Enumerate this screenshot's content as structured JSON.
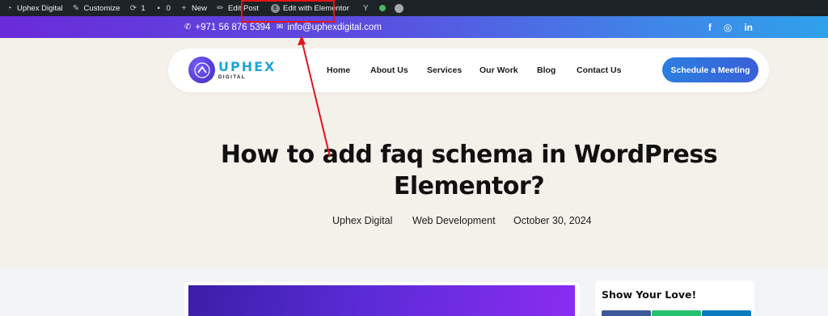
{
  "adminbar": {
    "items": [
      {
        "icon": "dashboard-icon",
        "label": "Uphex Digital"
      },
      {
        "icon": "brush-icon",
        "label": "Customize"
      },
      {
        "icon": "updates-icon",
        "label": "1"
      },
      {
        "icon": "comment-icon",
        "label": "0"
      },
      {
        "icon": "plus-icon",
        "label": "New"
      },
      {
        "icon": "pencil-icon",
        "label": "Edit Post"
      },
      {
        "icon": "elementor-icon",
        "label": "Edit with Elementor"
      }
    ],
    "highlight_color": "#e5141a"
  },
  "topbar": {
    "phone": "+971 56 876 5394",
    "email": "info@uphexdigital.com",
    "socials": [
      "f",
      "◎",
      "in"
    ]
  },
  "header": {
    "logo_text": "UPHEX",
    "logo_sub": "DIGITAL",
    "nav": [
      "Home",
      "About Us",
      "Services",
      "Our Work",
      "Blog",
      "Contact Us"
    ],
    "cta": "Schedule a Meeting"
  },
  "post": {
    "title_line1": "How to add faq schema in WordPress",
    "title_line2": "Elementor?",
    "author": "Uphex Digital",
    "category": "Web Development",
    "date": "October 30, 2024"
  },
  "sidebar": {
    "title": "Show Your Love!"
  },
  "colors": {
    "accent": "#2b7fe0",
    "brand_purple": "#6a2bd9",
    "admin_bar": "#1d2327",
    "page_bg": "#f4f1ea"
  }
}
